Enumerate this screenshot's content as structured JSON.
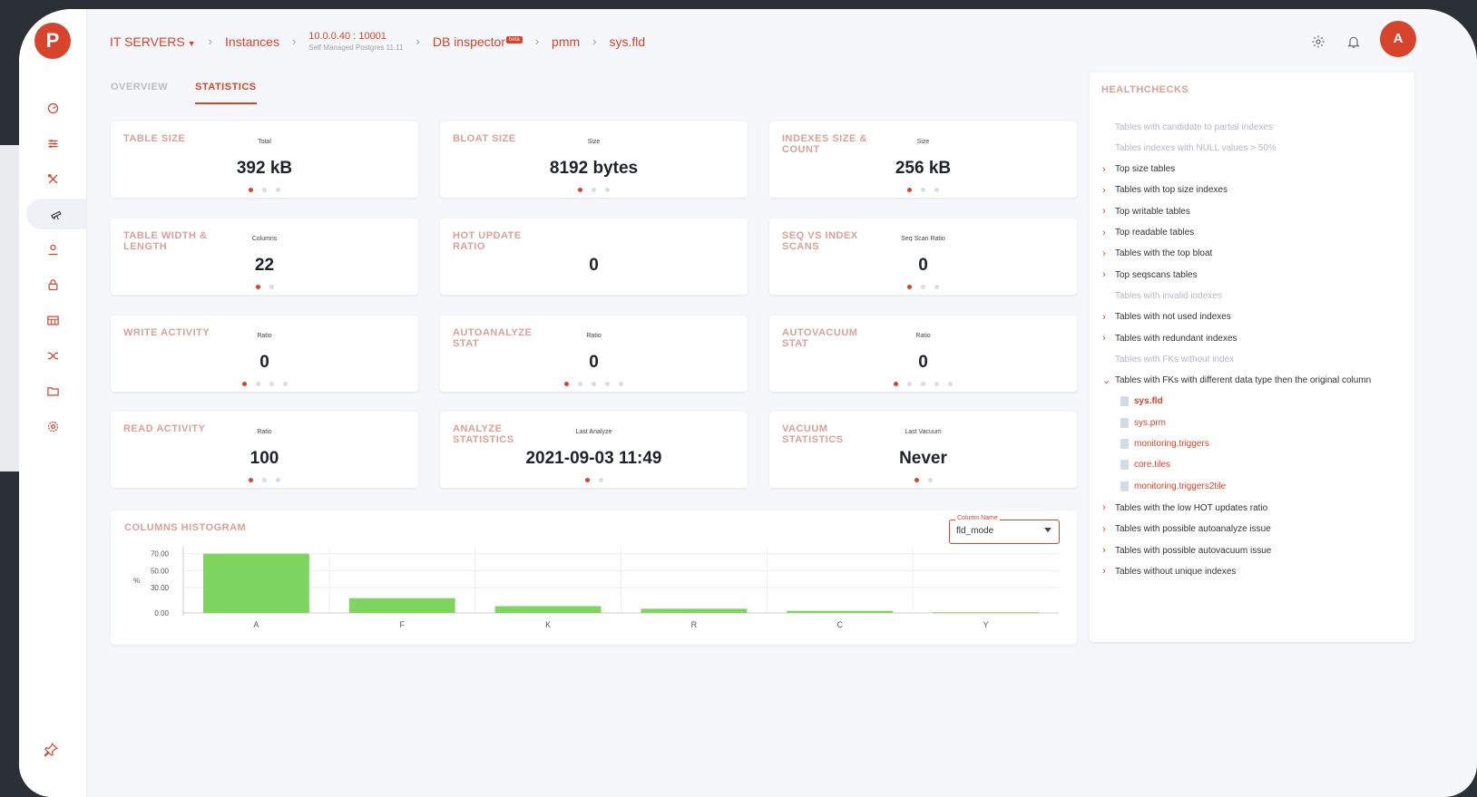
{
  "app": {
    "avatar_letter": "A",
    "accent": "#d8432b"
  },
  "breadcrumb": {
    "items": [
      "IT SERVERS",
      "Instances",
      "DB inspector",
      "pmm",
      "sys.fld"
    ],
    "host": "10.0.0.40 : 10001",
    "host_sub": "Self Managed Postgres 11.11",
    "beta_badge": "beta"
  },
  "sidebar": {
    "icons": [
      "dashboard-icon",
      "sliders-icon",
      "tools-icon",
      "telescope-icon",
      "user-icon",
      "lock-icon",
      "table-icon",
      "shuffle-icon",
      "folder-icon",
      "gear-icon"
    ],
    "active_index": 3
  },
  "tabs": [
    "OVERVIEW",
    "STATISTICS"
  ],
  "active_tab": 1,
  "cards": [
    {
      "title": "TABLE SIZE",
      "sub": "Total",
      "value": "392 kB",
      "dots": 3,
      "active_dot": 0
    },
    {
      "title": "BLOAT SIZE",
      "sub": "Size",
      "value": "8192 bytes",
      "dots": 3,
      "active_dot": 0
    },
    {
      "title": "INDEXES SIZE & COUNT",
      "sub": "Size",
      "value": "256 kB",
      "dots": 3,
      "active_dot": 0
    },
    {
      "title": "TABLE WIDTH & LENGTH",
      "sub": "Columns",
      "value": "22",
      "dots": 2,
      "active_dot": 0
    },
    {
      "title": "HOT UPDATE RATIO",
      "sub": "",
      "value": "0",
      "dots": 0,
      "active_dot": 0
    },
    {
      "title": "SEQ VS INDEX SCANS",
      "sub": "Seq Scan Ratio",
      "value": "0",
      "dots": 3,
      "active_dot": 0
    },
    {
      "title": "WRITE ACTIVITY",
      "sub": "Ratio",
      "value": "0",
      "dots": 4,
      "active_dot": 0
    },
    {
      "title": "AUTOANALYZE STAT",
      "sub": "Ratio",
      "value": "0",
      "dots": 5,
      "active_dot": 0
    },
    {
      "title": "AUTOVACUUM STAT",
      "sub": "Ratio",
      "value": "0",
      "dots": 5,
      "active_dot": 0
    },
    {
      "title": "READ ACTIVITY",
      "sub": "Ratio",
      "value": "100",
      "dots": 3,
      "active_dot": 0
    },
    {
      "title": "ANALYZE STATISTICS",
      "sub": "Last Analyze",
      "value": "2021-09-03 11:49",
      "dots": 2,
      "active_dot": 0
    },
    {
      "title": "VACUUM STATISTICS",
      "sub": "Last Vacuum",
      "value": "Never",
      "dots": 2,
      "active_dot": 0
    }
  ],
  "histogram": {
    "title": "COLUMNS HISTOGRAM",
    "select_label": "Column Name",
    "select_value": "fld_mode"
  },
  "chart_data": {
    "type": "bar",
    "categories": [
      "A",
      "F",
      "K",
      "R",
      "C",
      "Y"
    ],
    "values": [
      70.0,
      17.5,
      8.0,
      5.0,
      2.5,
      0.8
    ],
    "ylabel": "%",
    "yticks": [
      "70.00",
      "50.00",
      "30.00",
      "0.00"
    ],
    "ytick_values": [
      70,
      50,
      30,
      0
    ],
    "ylim": [
      0,
      75
    ],
    "bar_color": "#7ed55f",
    "grid": true
  },
  "healthchecks": {
    "title": "HEALTHCHECKS",
    "rows": [
      {
        "label": "Tables with candidate to partial indexes",
        "state": "disabled"
      },
      {
        "label": "Tables indexes with NULL values > 50%",
        "state": "disabled"
      },
      {
        "label": "Top size tables",
        "state": "collapsed"
      },
      {
        "label": "Tables with top size indexes",
        "state": "collapsed"
      },
      {
        "label": "Top writable tables",
        "state": "collapsed"
      },
      {
        "label": "Top readable tables",
        "state": "collapsed"
      },
      {
        "label": "Tables with the top bloat",
        "state": "collapsed"
      },
      {
        "label": "Top seqscans tables",
        "state": "collapsed"
      },
      {
        "label": "Tables with invalid indexes",
        "state": "disabled"
      },
      {
        "label": "Tables with not used indexes",
        "state": "collapsed"
      },
      {
        "label": "Tables with redundant indexes",
        "state": "collapsed"
      },
      {
        "label": "Tables with FKs without index",
        "state": "disabled"
      },
      {
        "label": "Tables with FKs with different data type then the original column",
        "state": "expanded",
        "children": [
          "sys.fld",
          "sys.prm",
          "monitoring.triggers",
          "core.tiles",
          "monitoring.triggers2tile"
        ],
        "selected_child": 0
      },
      {
        "label": "Tables with the low HOT updates ratio",
        "state": "collapsed"
      },
      {
        "label": "Tables with possible autoanalyze issue",
        "state": "collapsed"
      },
      {
        "label": "Tables with possible autovacuum issue",
        "state": "collapsed"
      },
      {
        "label": "Tables without unique indexes",
        "state": "collapsed"
      }
    ]
  }
}
